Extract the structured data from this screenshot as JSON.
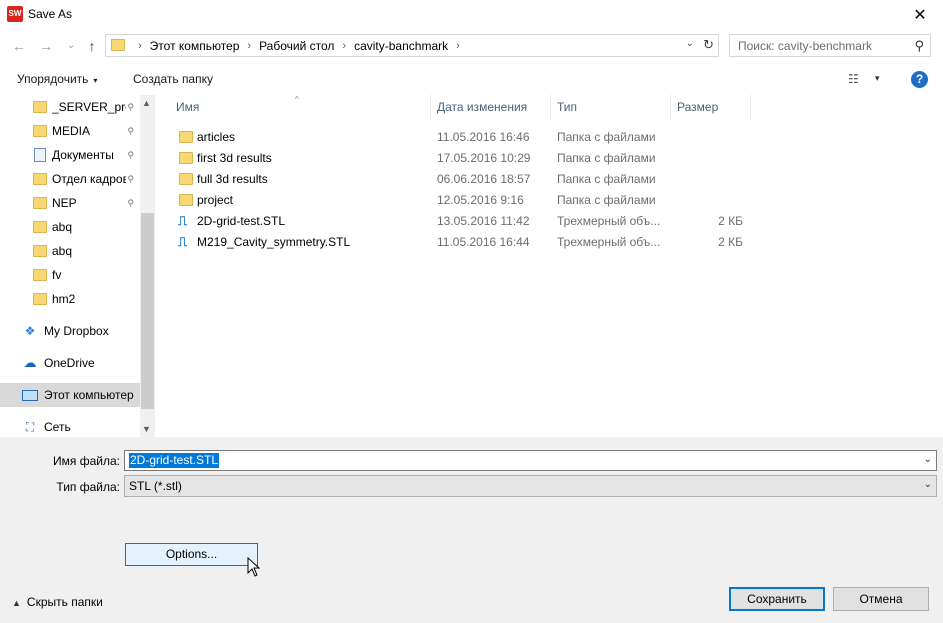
{
  "window": {
    "title": "Save As",
    "app_icon": "solidworks-icon",
    "close_glyph": "✕"
  },
  "address": {
    "back_glyph": "←",
    "forward_glyph": "→",
    "recent_glyph": "⌄",
    "up_glyph": "↑",
    "crumbs": [
      "Этот компьютер",
      "Рабочий стол",
      "cavity-banchmark"
    ],
    "separator": "›",
    "dropdown_glyph": "⌄",
    "refresh_glyph": "↻"
  },
  "search": {
    "placeholder": "Поиск: cavity-benchmark",
    "icon": "⚲"
  },
  "toolbar": {
    "organize_label": "Упорядочить",
    "new_folder_label": "Создать папку",
    "caret": "▾",
    "view_icon": "☷",
    "help_label": "?"
  },
  "navpane": {
    "items": [
      {
        "label": "_SERVER_proj",
        "icon": "folder",
        "pinned": true
      },
      {
        "label": "MEDIA",
        "icon": "folder",
        "pinned": true
      },
      {
        "label": "Документы",
        "icon": "document",
        "pinned": true
      },
      {
        "label": "Отдел кадров",
        "icon": "folder",
        "pinned": true
      },
      {
        "label": "NEP",
        "icon": "folder",
        "pinned": true
      },
      {
        "label": "abq",
        "icon": "folder",
        "pinned": false
      },
      {
        "label": "abq",
        "icon": "folder",
        "pinned": false
      },
      {
        "label": "fv",
        "icon": "folder",
        "pinned": false
      },
      {
        "label": "hm2",
        "icon": "folder",
        "pinned": false
      },
      {
        "label": "My Dropbox",
        "icon": "dropbox",
        "pinned": false
      },
      {
        "label": "OneDrive",
        "icon": "cloud",
        "pinned": false
      },
      {
        "label": "Этот компьютер",
        "icon": "computer",
        "pinned": false,
        "selected": true
      },
      {
        "label": "Сеть",
        "icon": "network",
        "pinned": false
      }
    ],
    "pin_glyph": "📌",
    "scroll_up": "▲",
    "scroll_down": "▼"
  },
  "filelist": {
    "columns": [
      "Имя",
      "Дата изменения",
      "Тип",
      "Размер"
    ],
    "sort_glyph": "^",
    "rows": [
      {
        "name": "articles",
        "date": "11.05.2016 16:46",
        "type": "Папка с файлами",
        "size": "",
        "icon": "folder"
      },
      {
        "name": "first 3d results",
        "date": "17.05.2016 10:29",
        "type": "Папка с файлами",
        "size": "",
        "icon": "folder"
      },
      {
        "name": "full 3d results",
        "date": "06.06.2016 18:57",
        "type": "Папка с файлами",
        "size": "",
        "icon": "folder"
      },
      {
        "name": "project",
        "date": "12.05.2016 9:16",
        "type": "Папка с файлами",
        "size": "",
        "icon": "folder"
      },
      {
        "name": "2D-grid-test.STL",
        "date": "13.05.2016 11:42",
        "type": "Трехмерный объ...",
        "size": "2 КБ",
        "icon": "stl"
      },
      {
        "name": "M219_Cavity_symmetry.STL",
        "date": "11.05.2016 16:44",
        "type": "Трехмерный объ...",
        "size": "2 КБ",
        "icon": "stl"
      }
    ]
  },
  "form": {
    "filename_label": "Имя файла:",
    "filename_value": "2D-grid-test.STL",
    "filetype_label": "Тип файла:",
    "filetype_value": "STL (*.stl)",
    "dropdown_glyph": "⌄",
    "options_label": "Options...",
    "hide_folders_label": "Скрыть папки",
    "hide_folders_caret": "▲",
    "save_label": "Сохранить",
    "cancel_label": "Отмена"
  },
  "colors": {
    "accent": "#0078d7",
    "selection": "#0078d7",
    "folder": "#f8d775",
    "panel": "#f0f0f0"
  }
}
